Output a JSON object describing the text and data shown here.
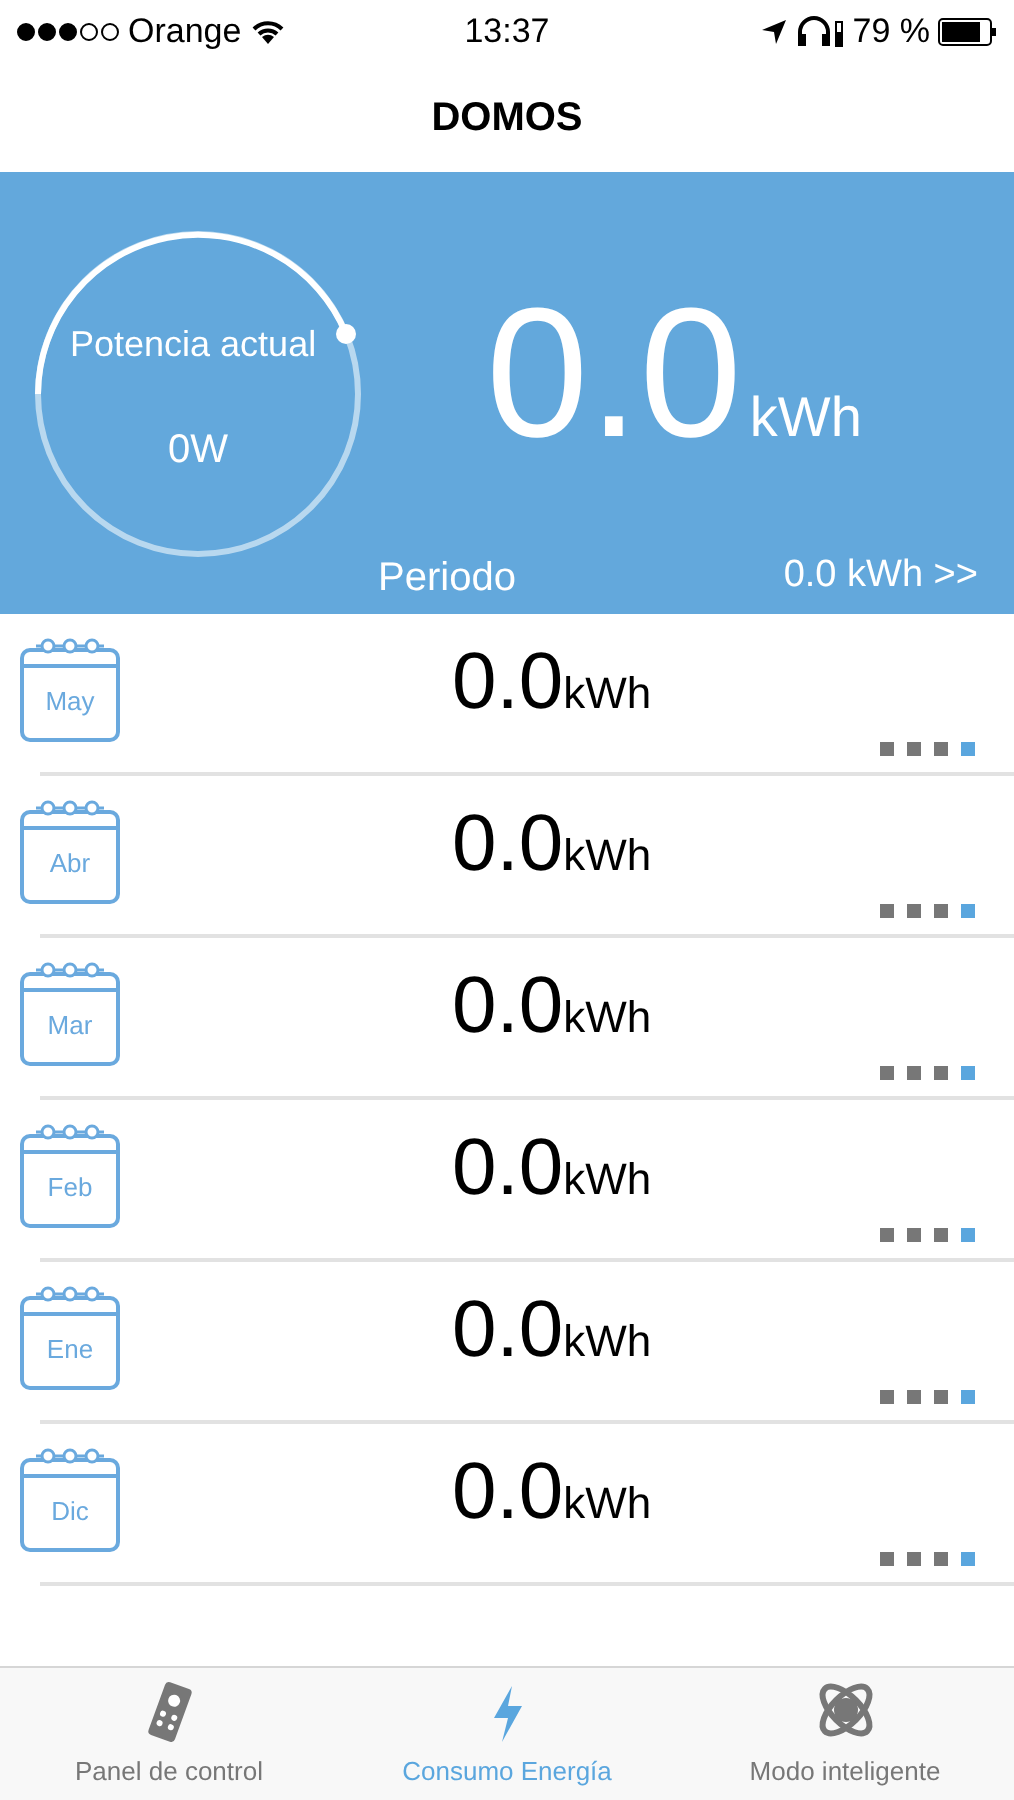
{
  "status_bar": {
    "carrier": "Orange",
    "time": "13:37",
    "battery": "79 %"
  },
  "nav": {
    "title": "DOMOS"
  },
  "summary": {
    "gauge_label": "Potencia actual",
    "gauge_value": "0W",
    "total": "0.0",
    "total_unit": "kWh",
    "period_label": "Periodo",
    "period_value": "0.0 kWh >>"
  },
  "months": [
    {
      "month": "May",
      "value": "0.0",
      "unit": "kWh"
    },
    {
      "month": "Abr",
      "value": "0.0",
      "unit": "kWh"
    },
    {
      "month": "Mar",
      "value": "0.0",
      "unit": "kWh"
    },
    {
      "month": "Feb",
      "value": "0.0",
      "unit": "kWh"
    },
    {
      "month": "Ene",
      "value": "0.0",
      "unit": "kWh"
    },
    {
      "month": "Dic",
      "value": "0.0",
      "unit": "kWh"
    }
  ],
  "tabs": [
    {
      "kind": "remote",
      "label": "Panel de control",
      "selected": false
    },
    {
      "kind": "bolt",
      "label": "Consumo Energía",
      "selected": true
    },
    {
      "kind": "atom",
      "label": "Modo inteligente",
      "selected": false
    }
  ]
}
